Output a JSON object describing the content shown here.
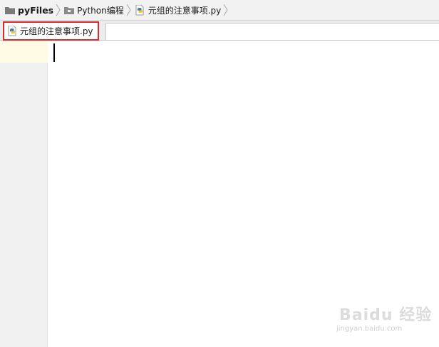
{
  "breadcrumb": {
    "items": [
      {
        "label": "pyFiles",
        "icon": "folder-icon"
      },
      {
        "label": "Python编程",
        "icon": "folder-icon"
      },
      {
        "label": "元组的注意事项.py",
        "icon": "python-file-icon"
      }
    ]
  },
  "tabs": [
    {
      "label": "元组的注意事项.py",
      "icon": "python-file-icon",
      "active": true
    }
  ],
  "watermark": {
    "brand": "Baidu 经验",
    "url": "jingyan.baidu.com"
  },
  "colors": {
    "highlight_border": "#e0252b",
    "current_line": "#fffae3",
    "python_blue": "#3d7ab5",
    "python_yellow": "#f4c430"
  }
}
